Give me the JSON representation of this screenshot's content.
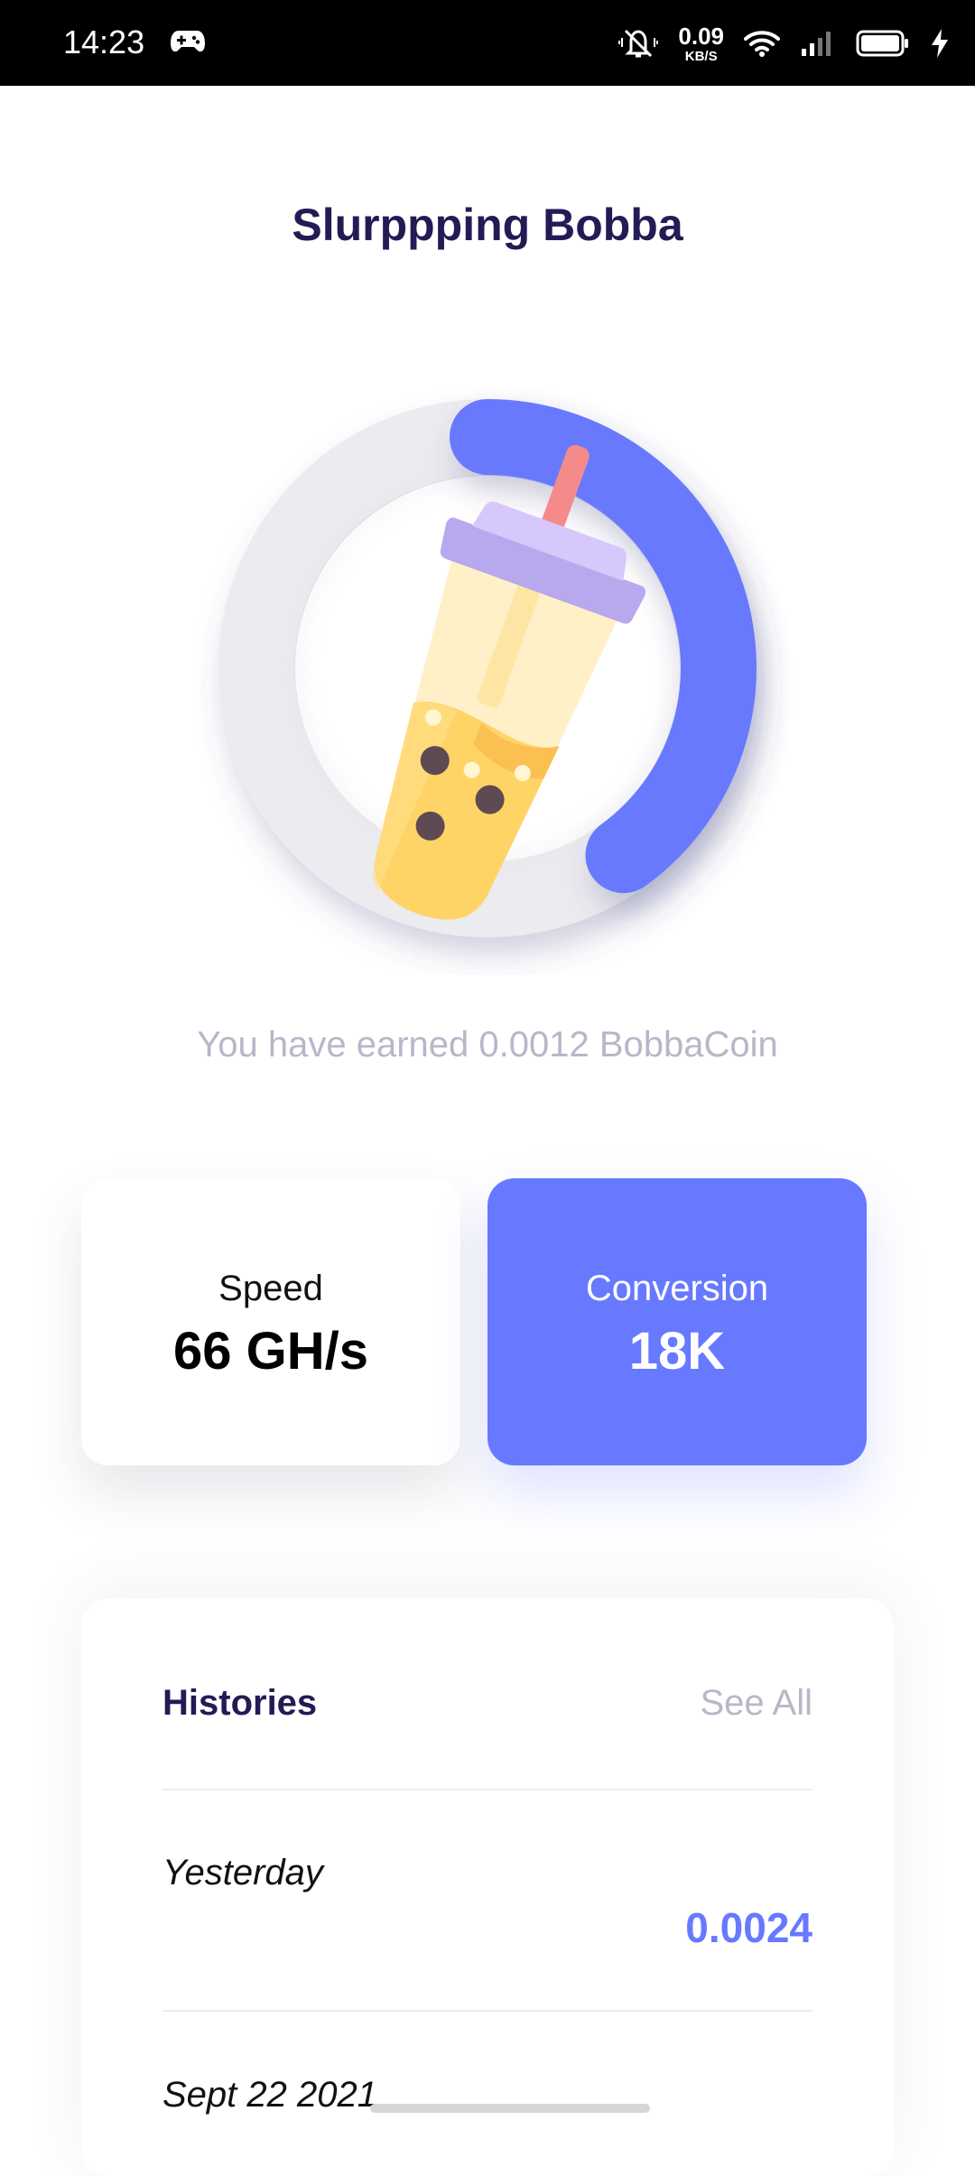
{
  "status_bar": {
    "time": "14:23",
    "net_speed_value": "0.09",
    "net_speed_unit": "KB/S",
    "icons": [
      "gamepad-icon",
      "mute-icon",
      "wifi-icon",
      "signal-icon",
      "battery-icon",
      "charging-icon"
    ]
  },
  "header": {
    "title": "Slurppping Bobba"
  },
  "gauge": {
    "progress": 0.4,
    "track_color": "#ecebef",
    "fill_color": "#6779fe",
    "icon": "bubble-tea-icon"
  },
  "earned_text": "You have earned 0.0012 BobbaCoin",
  "stats": {
    "speed": {
      "label": "Speed",
      "value": "66 GH/s"
    },
    "conversion": {
      "label": "Conversion",
      "value": "18K"
    }
  },
  "histories": {
    "title": "Histories",
    "see_all": "See All",
    "items": [
      {
        "date": "Yesterday",
        "amount": "0.0024"
      },
      {
        "date": "Sept 22 2021",
        "amount": ""
      }
    ]
  },
  "colors": {
    "accent": "#6779fe",
    "title": "#261a55",
    "muted": "#b9b6c9"
  }
}
